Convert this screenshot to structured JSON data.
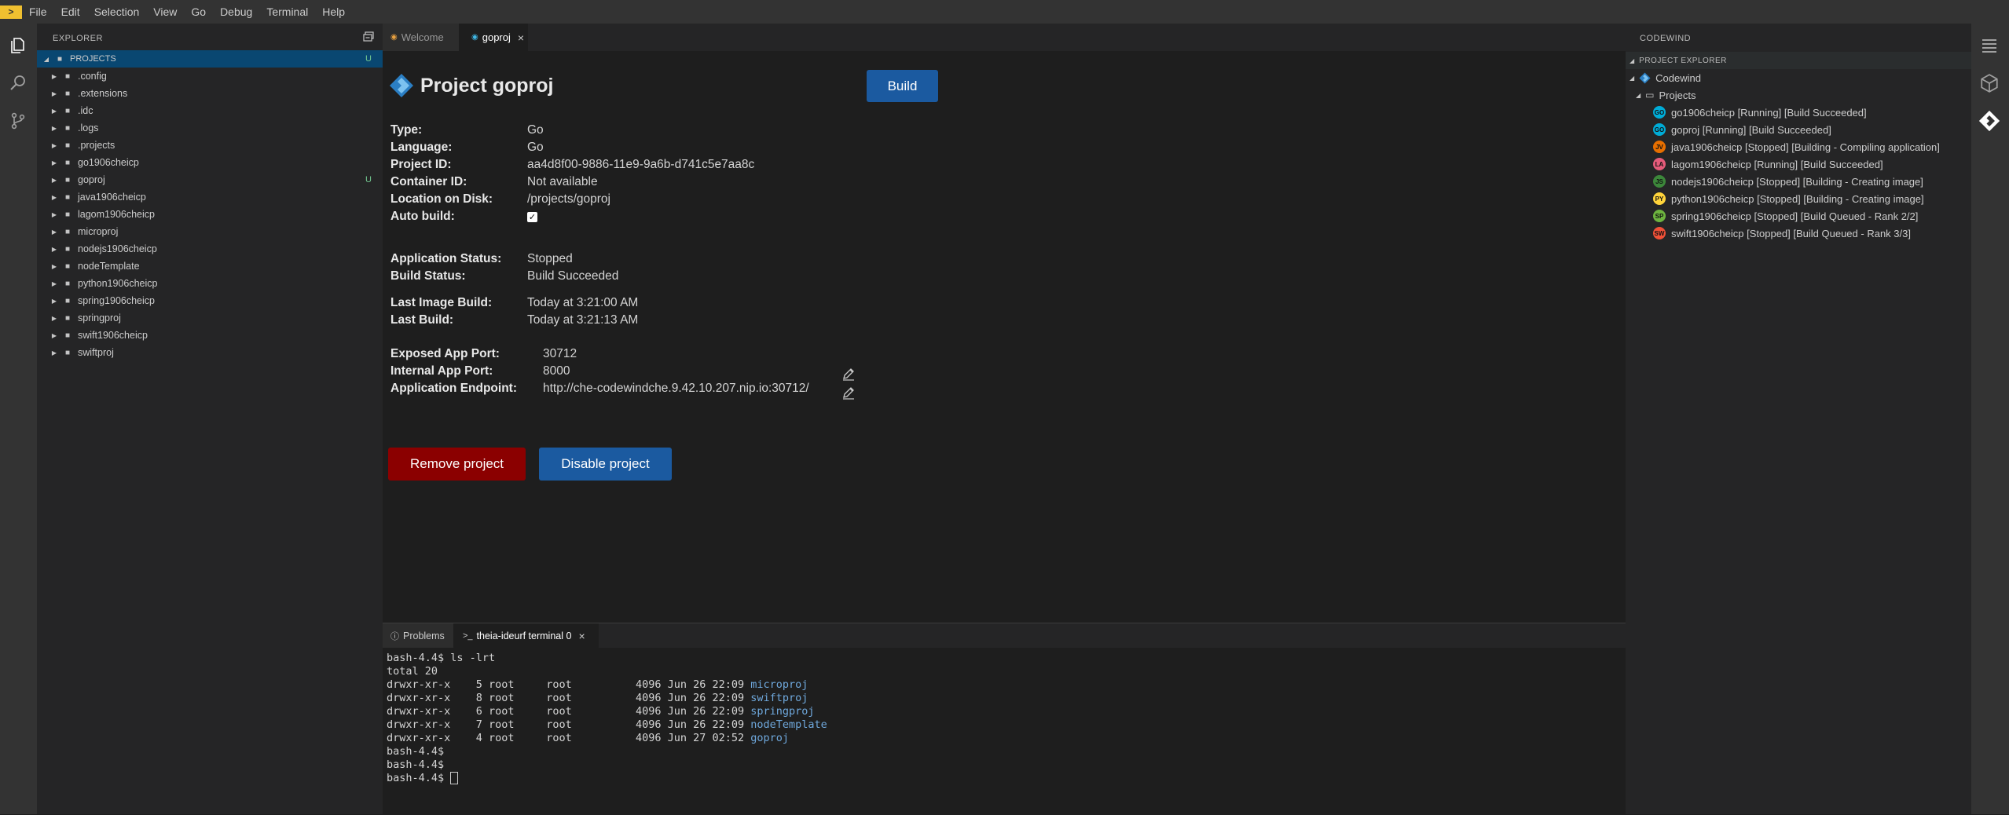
{
  "app": {
    "logo": ">"
  },
  "menu": [
    "File",
    "Edit",
    "Selection",
    "View",
    "Go",
    "Debug",
    "Terminal",
    "Help"
  ],
  "explorer": {
    "title": "EXPLORER",
    "root": "PROJECTS",
    "root_badge": "U",
    "items": [
      {
        "label": ".config"
      },
      {
        "label": ".extensions"
      },
      {
        "label": ".idc"
      },
      {
        "label": ".logs"
      },
      {
        "label": ".projects"
      },
      {
        "label": "go1906cheicp"
      },
      {
        "label": "goproj",
        "badge": "U"
      },
      {
        "label": "java1906cheicp"
      },
      {
        "label": "lagom1906cheicp"
      },
      {
        "label": "microproj"
      },
      {
        "label": "nodejs1906cheicp"
      },
      {
        "label": "nodeTemplate"
      },
      {
        "label": "python1906cheicp"
      },
      {
        "label": "spring1906cheicp"
      },
      {
        "label": "springproj"
      },
      {
        "label": "swift1906cheicp"
      },
      {
        "label": "swiftproj"
      }
    ]
  },
  "tabs": [
    {
      "label": "Welcome"
    },
    {
      "label": "goproj",
      "close": "×"
    }
  ],
  "project": {
    "title": "Project goproj",
    "build_button": "Build",
    "fields1": [
      {
        "label": "Type:",
        "value": "Go"
      },
      {
        "label": "Language:",
        "value": "Go"
      },
      {
        "label": "Project ID:",
        "value": "aa4d8f00-9886-11e9-9a6b-d741c5e7aa8c"
      },
      {
        "label": "Container ID:",
        "value": "Not available"
      },
      {
        "label": "Location on Disk:",
        "value": "/projects/goproj"
      },
      {
        "label": "Auto build:",
        "value": "✓"
      }
    ],
    "fields2": [
      {
        "label": "Application Status:",
        "value": "Stopped"
      },
      {
        "label": "Build Status:",
        "value": "Build Succeeded"
      }
    ],
    "fields3": [
      {
        "label": "Last Image Build:",
        "value": "Today at 3:21:00 AM"
      },
      {
        "label": "Last Build:",
        "value": "Today at 3:21:13 AM"
      }
    ],
    "fields4": [
      {
        "label": "Exposed App Port:",
        "value": "30712"
      },
      {
        "label": "Internal App Port:",
        "value": "8000"
      },
      {
        "label": "Application Endpoint:",
        "value": "http://che-codewindche.9.42.10.207.nip.io:30712/"
      }
    ],
    "remove_button": "Remove project",
    "disable_button": "Disable project",
    "colors": {
      "build": "#1b5aa0",
      "remove": "#8b0000",
      "disable": "#1b5aa0"
    }
  },
  "panel": {
    "tabs": [
      {
        "label": "Problems"
      },
      {
        "label": "theia-ideurf terminal 0",
        "close": "×"
      }
    ],
    "terminal": [
      {
        "text": "bash-4.4$ ls -lrt"
      },
      {
        "text": "total 20"
      },
      {
        "text": "drwxr-xr-x    5 root     root          4096 Jun 26 22:09 ",
        "dir": "microproj"
      },
      {
        "text": "drwxr-xr-x    8 root     root          4096 Jun 26 22:09 ",
        "dir": "swiftproj"
      },
      {
        "text": "drwxr-xr-x    6 root     root          4096 Jun 26 22:09 ",
        "dir": "springproj"
      },
      {
        "text": "drwxr-xr-x    7 root     root          4096 Jun 26 22:09 ",
        "dir": "nodeTemplate"
      },
      {
        "text": "drwxr-xr-x    4 root     root          4096 Jun 27 02:52 ",
        "dir": "goproj"
      },
      {
        "text": "bash-4.4$"
      },
      {
        "text": "bash-4.4$"
      },
      {
        "text": "bash-4.4$ "
      }
    ]
  },
  "codewind": {
    "title": "CODEWIND",
    "section": "PROJECT EXPLORER",
    "root": "Codewind",
    "projects_label": "Projects",
    "projects": [
      {
        "label": "go1906cheicp [Running] [Build Succeeded]",
        "lang": "GO",
        "color": "#00acd7"
      },
      {
        "label": "goproj [Running] [Build Succeeded]",
        "lang": "GO",
        "color": "#00acd7"
      },
      {
        "label": "java1906cheicp [Stopped] [Building - Compiling application]",
        "lang": "JV",
        "color": "#e76f00"
      },
      {
        "label": "lagom1906cheicp [Running] [Build Succeeded]",
        "lang": "LA",
        "color": "#e45b7a"
      },
      {
        "label": "nodejs1906cheicp [Stopped] [Building - Creating image]",
        "lang": "JS",
        "color": "#3c873a"
      },
      {
        "label": "python1906cheicp [Stopped] [Building - Creating image]",
        "lang": "PY",
        "color": "#ffd43b"
      },
      {
        "label": "spring1906cheicp [Stopped] [Build Queued - Rank 2/2]",
        "lang": "SP",
        "color": "#6db33f"
      },
      {
        "label": "swift1906cheicp [Stopped] [Build Queued - Rank 3/3]",
        "lang": "SW",
        "color": "#f05138"
      }
    ]
  }
}
